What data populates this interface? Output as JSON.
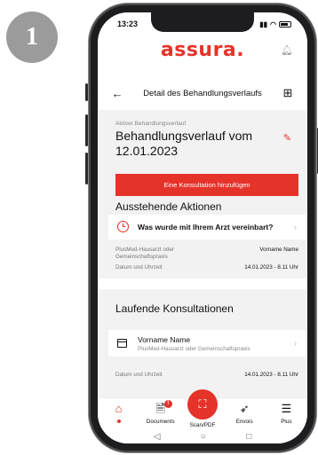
{
  "step": {
    "number": "1"
  },
  "status_bar": {
    "time": "13:23"
  },
  "brand": {
    "logo_text": "assura.",
    "accent_color": "#e6332a"
  },
  "header": {
    "title": "Detail des Behandlungsverlaufs"
  },
  "detail": {
    "label": "Aktiver Behandlungsverlauf",
    "title": "Behandlungsverlauf vom 12.01.2023",
    "add_button_label": "Eine Konsultation hinzufügen"
  },
  "pending": {
    "section_title": "Ausstehende Aktionen",
    "action_label": "Was wurde mit Ihrem Arzt vereinbart?",
    "practice_label": "PlusMed-Hausarzt oder Gemeinschaftspraxis",
    "practice_value": "Vorname Name",
    "date_label": "Datum und Uhrzeit",
    "date_value": "14.01.2023 - 8.11 Uhr"
  },
  "ongoing": {
    "section_title": "Laufende Konsultationen",
    "consultation_name": "Vorname Name",
    "consultation_sub": "PlusMed-Hausarzt oder Gemeinschaftspraxis",
    "date_label": "Datum und Uhrzeit",
    "date_value": "14.01.2023 - 8.11 Uhr"
  },
  "tabs": [
    {
      "label": "",
      "icon": "home-icon"
    },
    {
      "label": "Documents",
      "icon": "document-icon",
      "badge": "!"
    },
    {
      "label": "Scan/PDF",
      "icon": "scan-icon"
    },
    {
      "label": "Envois",
      "icon": "send-icon"
    },
    {
      "label": "Plus",
      "icon": "menu-icon"
    }
  ]
}
